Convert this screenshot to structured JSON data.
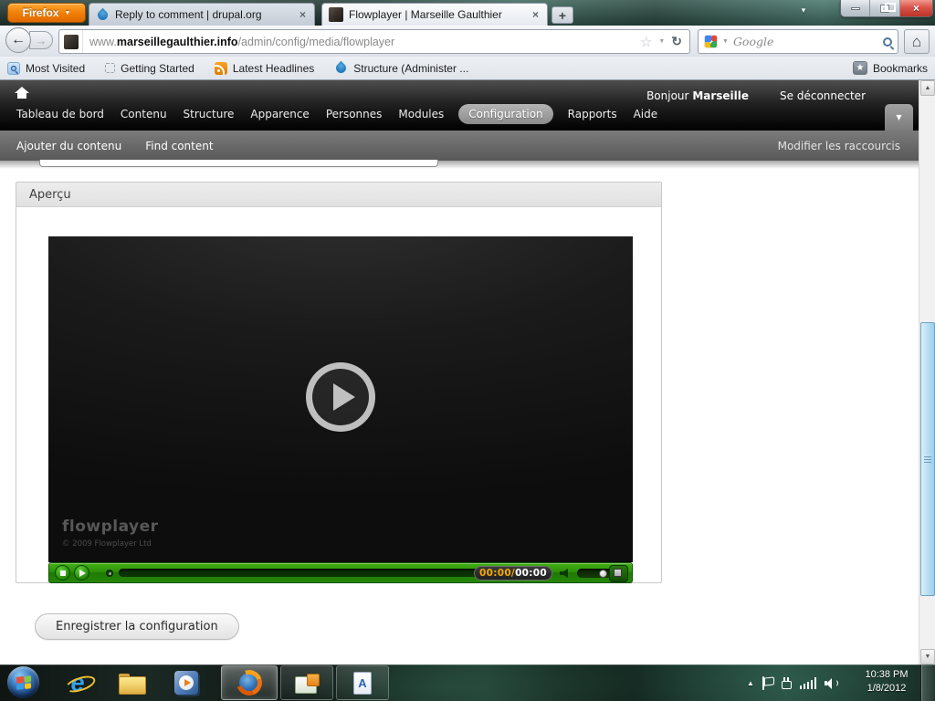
{
  "window": {
    "firefox_button_label": "Firefox",
    "tabs": [
      {
        "title": "Reply to comment | drupal.org"
      },
      {
        "title": "Flowplayer | Marseille Gaulthier"
      }
    ]
  },
  "navbar": {
    "url_prefix": "www.",
    "url_domain": "marseillegaulthier.info",
    "url_path": "/admin/config/media/flowplayer",
    "search_placeholder": "Google"
  },
  "bookmarks_bar": {
    "items": [
      "Most Visited",
      "Getting Started",
      "Latest Headlines",
      "Structure (Administer ..."
    ],
    "bookmarks_label": "Bookmarks"
  },
  "admin_toolbar": {
    "items": [
      "Tableau de bord",
      "Contenu",
      "Structure",
      "Apparence",
      "Personnes",
      "Modules",
      "Configuration",
      "Rapports",
      "Aide"
    ],
    "active_item": "Configuration",
    "greeting": "Bonjour",
    "username": "Marseille",
    "logout": "Se déconnecter"
  },
  "shortcut_bar": {
    "items": [
      "Ajouter du contenu",
      "Find content"
    ],
    "edit_label": "Modifier les raccourcis"
  },
  "content": {
    "fieldset_legend": "Aperçu",
    "player": {
      "logo": "flowplayer",
      "copyright": "© 2009 Flowplayer Ltd",
      "time_elapsed": "00:00/",
      "time_total": "00:00"
    },
    "save_button": "Enregistrer la configuration"
  },
  "taskbar": {
    "time": "10:38 PM",
    "date": "1/8/2012"
  },
  "icons": {
    "caret_down": "▼",
    "close": "×",
    "plus": "+",
    "back_arrow": "←",
    "forward_arrow": "→",
    "reload": "↻",
    "star_outline": "☆",
    "star_solid": "★",
    "home": "⌂",
    "tray_expand": "▲",
    "scroll_up": "▲",
    "scroll_down": "▼",
    "ie_letter": "e",
    "doc_letter": "A"
  },
  "colors": {
    "player_green": "#2d9009",
    "time_elapsed_orange": "#f5a800",
    "drupal_blue": "#1f76bb",
    "firefox_orange": "#f07d05"
  }
}
